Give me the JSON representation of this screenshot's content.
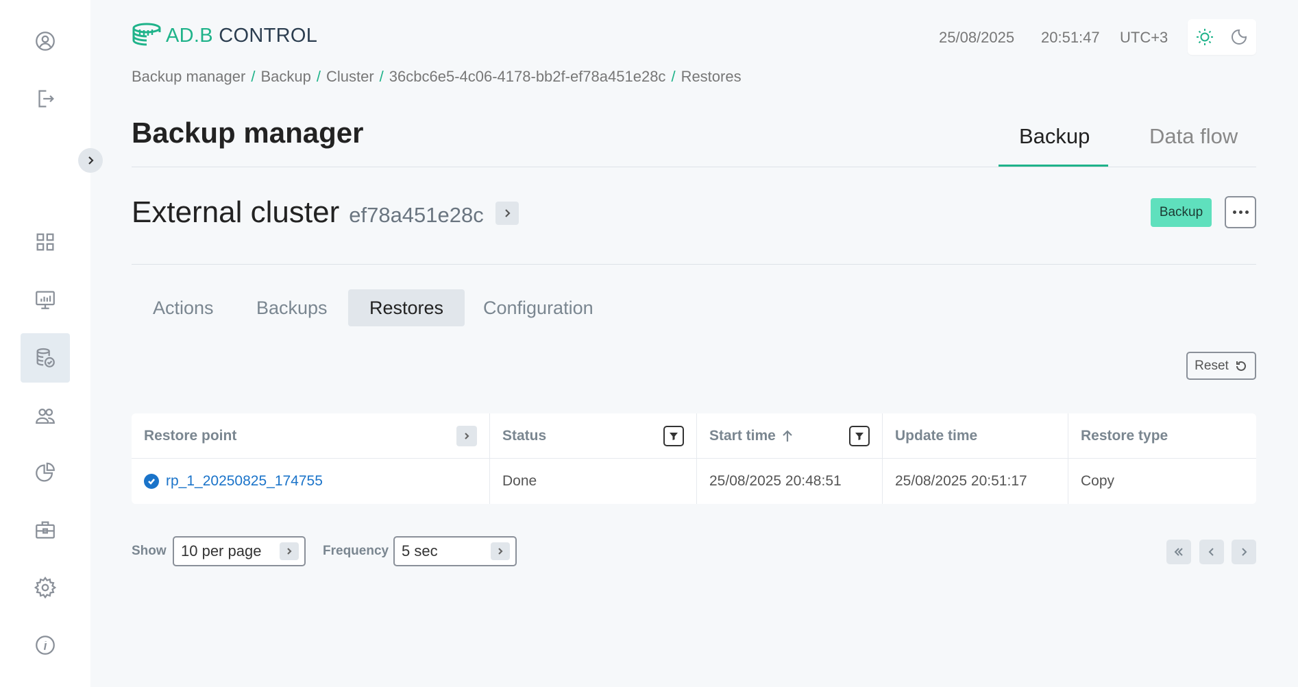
{
  "header": {
    "logo_text_ad": "AD.B",
    "logo_text_control": " CONTROL",
    "date": "25/08/2025",
    "time": "20:51:47",
    "timezone": "UTC+3"
  },
  "breadcrumb": [
    "Backup manager",
    "Backup",
    "Cluster",
    "36cbc6e5-4c06-4178-bb2f-ef78a451e28c",
    "Restores"
  ],
  "page": {
    "title": "Backup manager",
    "tabs": [
      {
        "label": "Backup",
        "active": true
      },
      {
        "label": "Data flow",
        "active": false
      }
    ]
  },
  "cluster": {
    "title": "External cluster",
    "id": "ef78a451e28c",
    "badge": "Backup"
  },
  "sub_tabs": [
    {
      "label": "Actions",
      "active": false
    },
    {
      "label": "Backups",
      "active": false
    },
    {
      "label": "Restores",
      "active": true
    },
    {
      "label": "Configuration",
      "active": false
    }
  ],
  "reset_label": "Reset",
  "table": {
    "columns": [
      "Restore point",
      "Status",
      "Start time",
      "Update time",
      "Restore type"
    ],
    "rows": [
      {
        "restore_point": "rp_1_20250825_174755",
        "status": "Done",
        "start_time": "25/08/2025 20:48:51",
        "update_time": "25/08/2025 20:51:17",
        "restore_type": "Copy"
      }
    ]
  },
  "pagination": {
    "show_label": "Show",
    "show_value": "10 per page",
    "frequency_label": "Frequency",
    "frequency_value": "5 sec"
  },
  "colors": {
    "accent": "#1fb38a",
    "link": "#1a73c9",
    "badge": "#5fe0bd"
  }
}
